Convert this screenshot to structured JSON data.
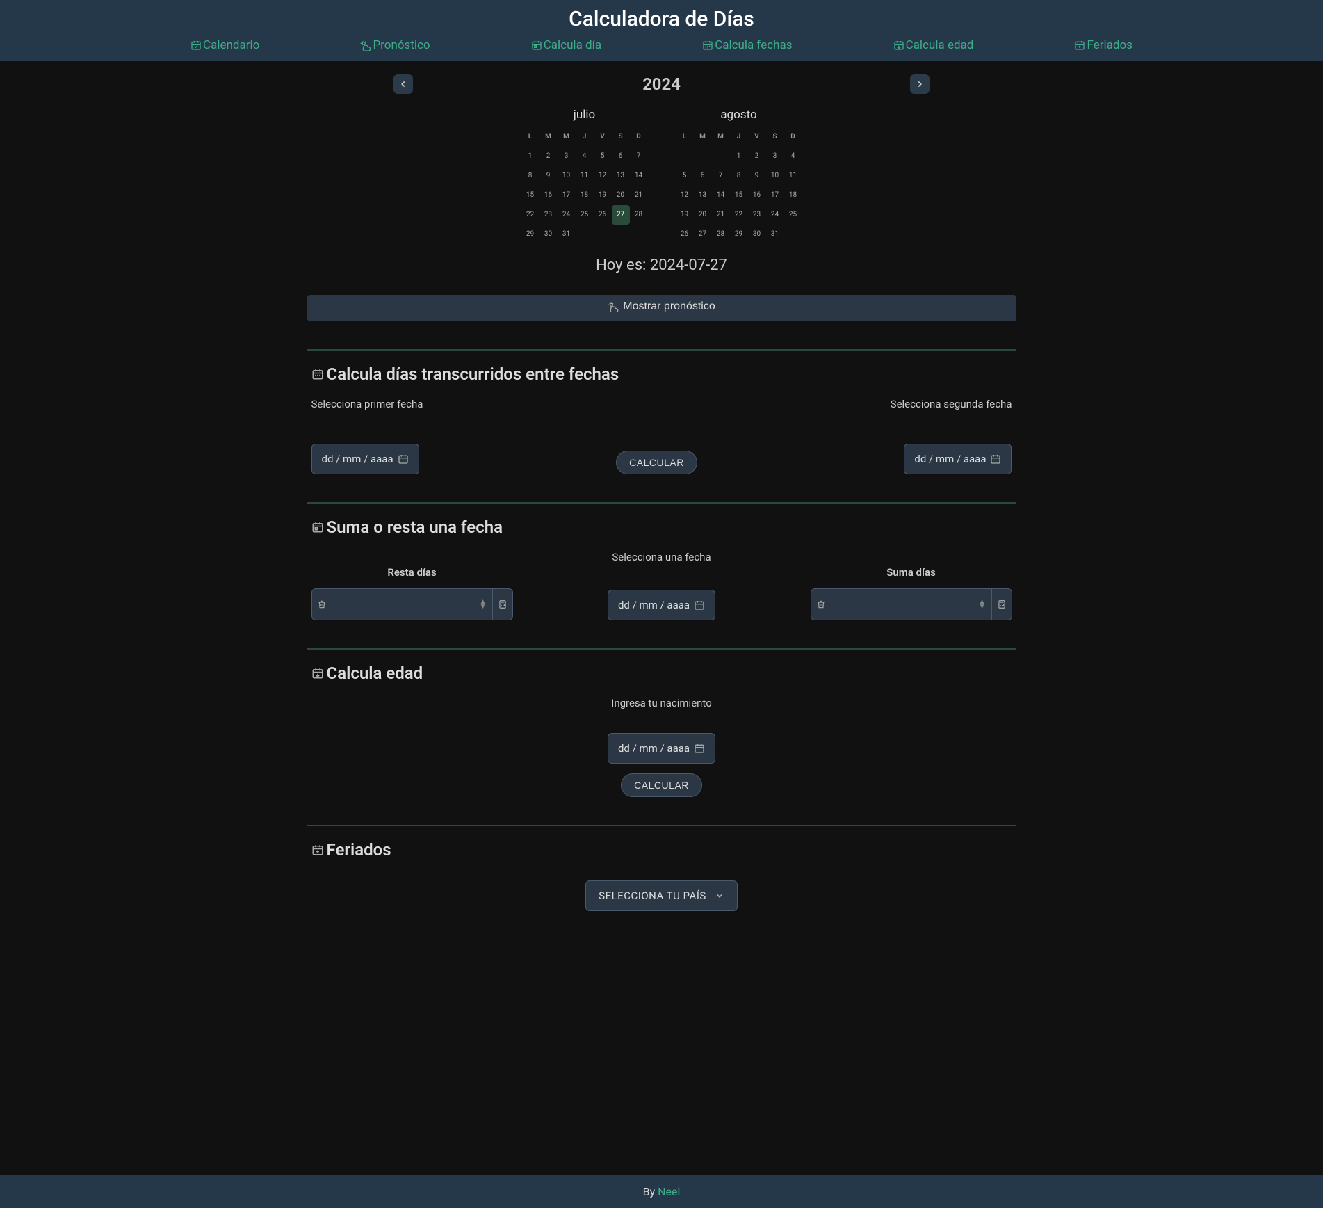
{
  "title": "Calculadora de Días",
  "nav": [
    {
      "label": "Calendario",
      "id": "calendario"
    },
    {
      "label": "Pronóstico",
      "id": "pronostico"
    },
    {
      "label": "Calcula día",
      "id": "calcula-dia"
    },
    {
      "label": "Calcula fechas",
      "id": "calcula-fechas"
    },
    {
      "label": "Calcula edad",
      "id": "calcula-edad"
    },
    {
      "label": "Feriados",
      "id": "feriados"
    }
  ],
  "year": "2024",
  "months": [
    {
      "name": "julio",
      "head": [
        "L",
        "M",
        "M",
        "J",
        "V",
        "S",
        "D"
      ],
      "offset": 0,
      "days": 31,
      "today": 27
    },
    {
      "name": "agosto",
      "head": [
        "L",
        "M",
        "M",
        "J",
        "V",
        "S",
        "D"
      ],
      "offset": 3,
      "days": 31,
      "today": null
    }
  ],
  "today_label": "Hoy es: 2024-07-27",
  "forecast_btn": "Mostrar pronóstico",
  "section_dates": {
    "title": "Calcula días transcurridos entre fechas",
    "left_label": "Selecciona primer fecha",
    "right_label": "Selecciona segunda fecha",
    "date_placeholder": "dd / mm / aaaa",
    "calc": "CALCULAR"
  },
  "section_addsub": {
    "title": "Suma o resta una fecha",
    "center_label": "Selecciona una fecha",
    "left_label": "Resta días",
    "right_label": "Suma días",
    "date_placeholder": "dd / mm / aaaa"
  },
  "section_age": {
    "title": "Calcula edad",
    "label": "Ingresa tu nacimiento",
    "date_placeholder": "dd / mm / aaaa",
    "calc": "CALCULAR"
  },
  "section_holidays": {
    "title": "Feriados",
    "select": "SELECCIONA TU PAÍS"
  },
  "footer": {
    "by": "By ",
    "name": "Neel"
  }
}
